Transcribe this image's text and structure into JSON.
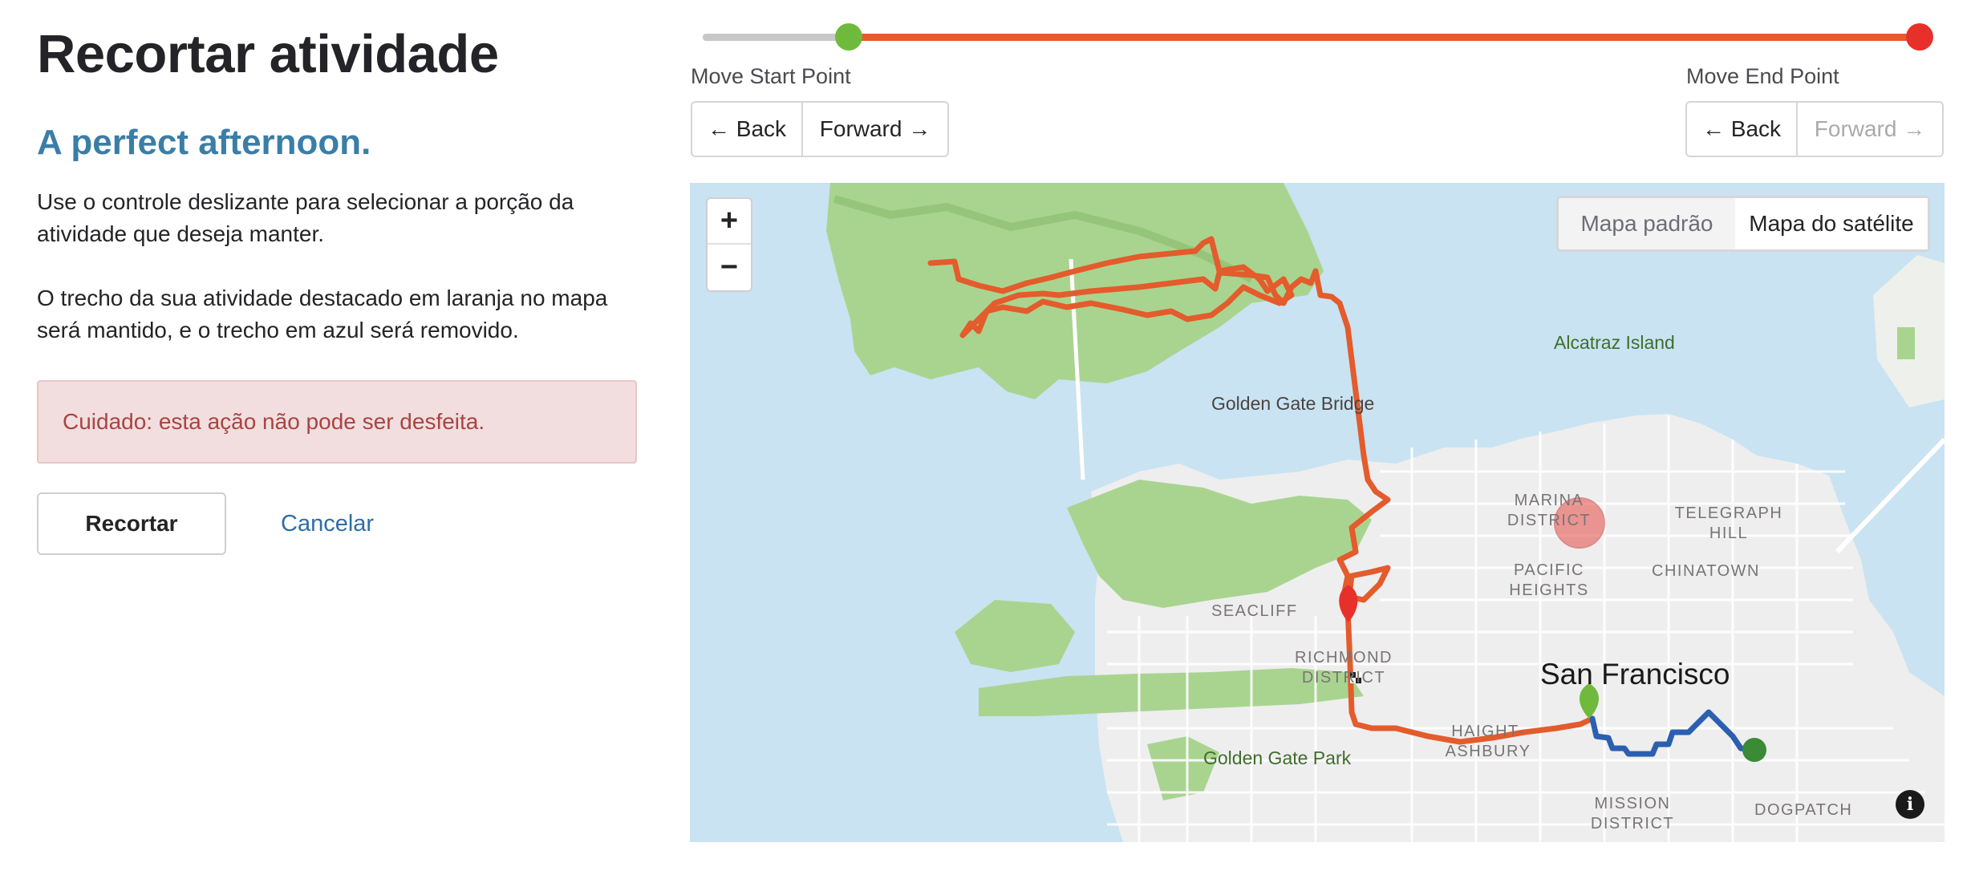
{
  "page": {
    "title": "Recortar atividade",
    "subtitle": "A perfect afternoon.",
    "paragraph_1": "Use o controle deslizante para selecionar a porção da atividade que deseja manter.",
    "paragraph_2": "O trecho da sua atividade destacado em laranja no mapa será mantido, e o trecho em azul será removido.",
    "warning": "Cuidado: esta ação não pode ser desfeita.",
    "crop_button": "Recortar",
    "cancel_link": "Cancelar"
  },
  "slider": {
    "start_fraction": 0.11,
    "end_fraction": 1.0,
    "colors": {
      "kept": "#e45b2c",
      "removed_track": "#c8c8c8",
      "start_handle": "#6fba3c",
      "end_handle": "#e8302a"
    }
  },
  "start_controls": {
    "label": "Move Start Point",
    "back": "← Back",
    "forward": "Forward →"
  },
  "end_controls": {
    "label": "Move End Point",
    "back": "← Back",
    "forward": "Forward →",
    "forward_disabled": true
  },
  "map": {
    "zoom_in": "+",
    "zoom_out": "−",
    "map_type_standard": "Mapa padrão",
    "map_type_satellite": "Mapa do satélite",
    "info_icon": "i",
    "labels": {
      "alcatraz": "Alcatraz Island",
      "golden_gate_bridge": "Golden Gate Bridge",
      "marina_district": "MARINA\nDISTRICT",
      "telegraph_hill": "TELEGRAPH\nHILL",
      "pacific_heights": "PACIFIC\nHEIGHTS",
      "chinatown": "CHINATOWN",
      "seacliff": "SEACLIFF",
      "richmond_district": "RICHMOND\nDISTRICT",
      "san_francisco": "San Francisco",
      "haight_ashbury": "HAIGHT-\nASHBURY",
      "golden_gate_park": "Golden Gate Park",
      "mission_district": "MISSION\nDISTRICT",
      "dogpatch": "DOGPATCH"
    },
    "colors": {
      "water": "#c9e3f2",
      "kept_route": "#e45b2c",
      "removed_route": "#2b5fb0",
      "park": "#a9d48f"
    }
  }
}
